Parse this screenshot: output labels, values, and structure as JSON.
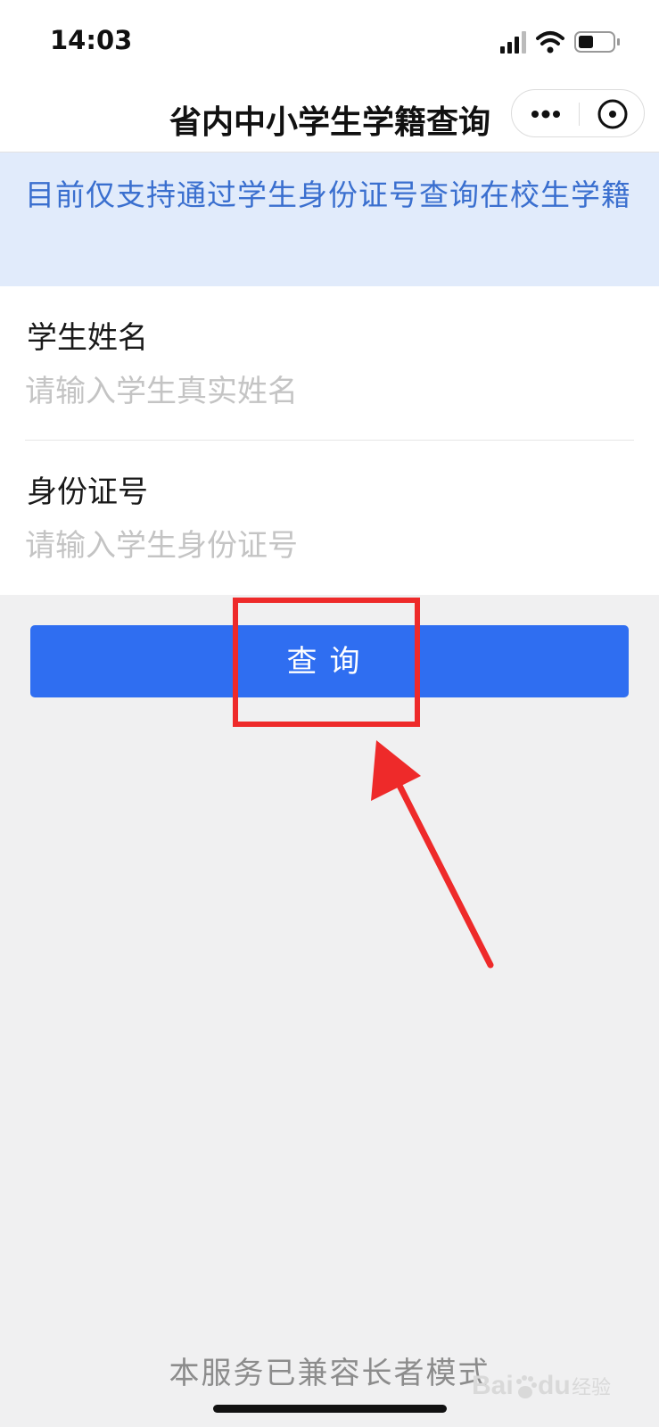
{
  "status_bar": {
    "time": "14:03",
    "icons": [
      "signal-icon",
      "wifi-icon",
      "battery-icon"
    ]
  },
  "nav": {
    "title": "省内中小学生学籍查询",
    "more_icon": "more-icon",
    "close_icon": "close-icon"
  },
  "notice": {
    "text": "目前仅支持通过学生身份证号查询在校生学籍"
  },
  "form": {
    "name_label": "学生姓名",
    "name_placeholder": "请输入学生真实姓名",
    "name_value": "",
    "id_label": "身份证号",
    "id_placeholder": "请输入学生身份证号",
    "id_value": ""
  },
  "query_button": {
    "label": "查询"
  },
  "footer": {
    "text": "本服务已兼容长者模式"
  },
  "watermark": {
    "text": "Baidu经验"
  },
  "colors": {
    "accent": "#2f6ef1",
    "notice_bg": "#e1ebfb",
    "notice_text": "#3a6fcf",
    "annotation": "#ee2a2a",
    "page_bg": "#f0f0f1"
  }
}
